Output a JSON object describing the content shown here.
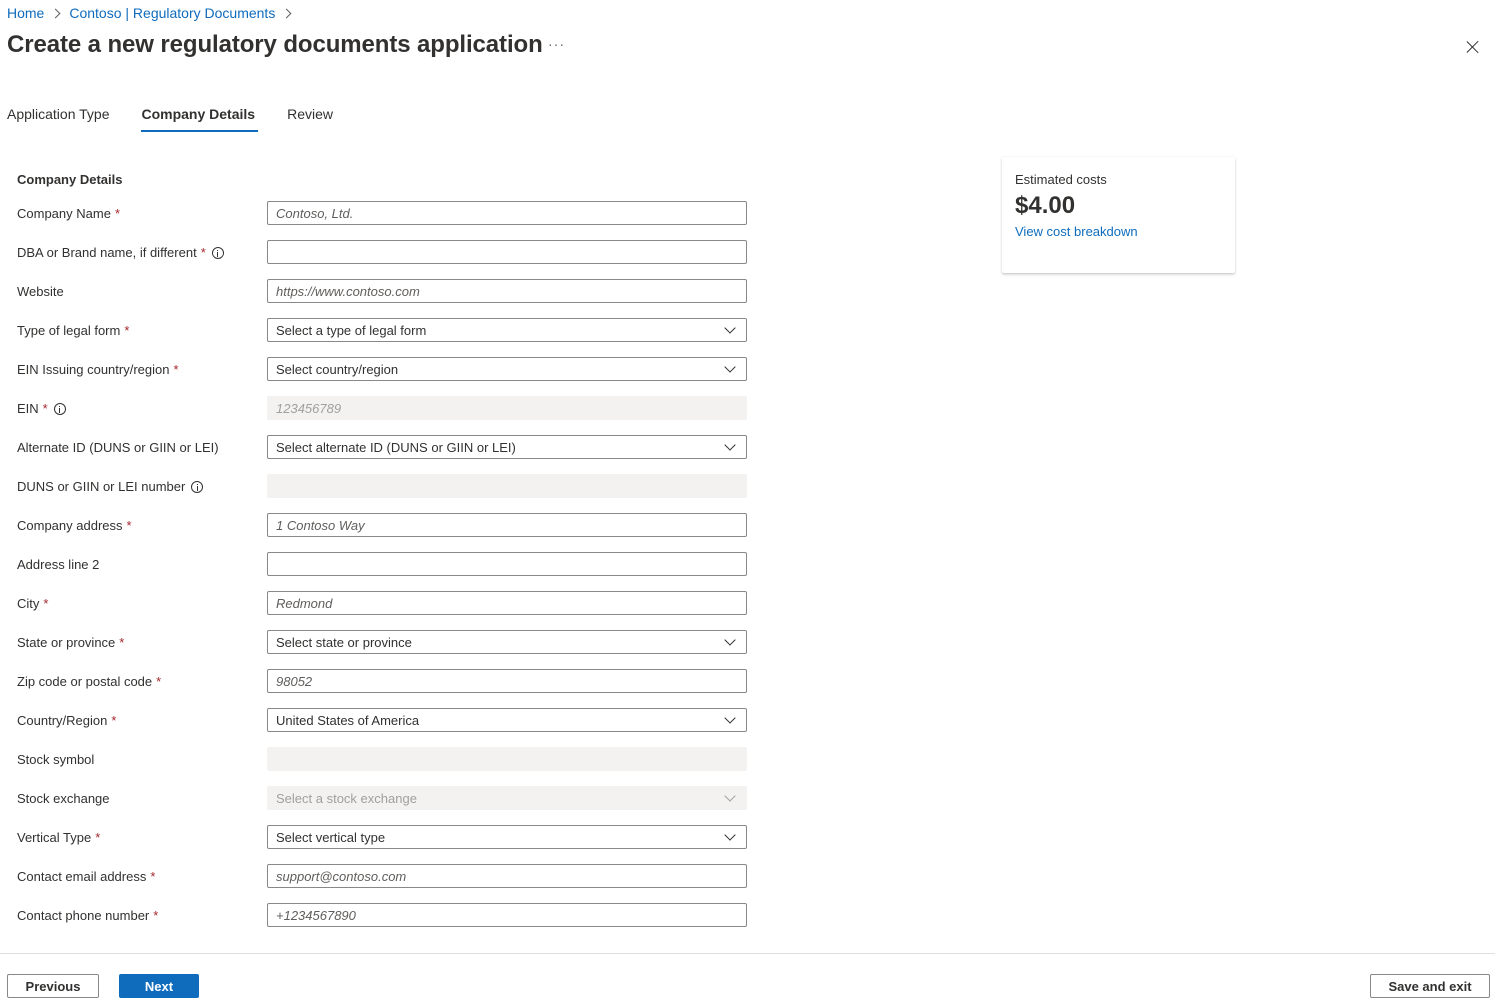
{
  "breadcrumb": {
    "items": [
      "Home",
      "Contoso | Regulatory Documents"
    ]
  },
  "header": {
    "title": "Create a new regulatory documents application",
    "more": "···"
  },
  "tabs": [
    {
      "label": "Application Type",
      "active": false
    },
    {
      "label": "Company Details",
      "active": true
    },
    {
      "label": "Review",
      "active": false
    }
  ],
  "form": {
    "section_title": "Company Details",
    "fields": {
      "company_name": {
        "label": "Company Name",
        "required": "*",
        "placeholder": "Contoso, Ltd."
      },
      "dba": {
        "label": "DBA or Brand name, if different",
        "required": "*",
        "placeholder": ""
      },
      "website": {
        "label": "Website",
        "placeholder": "https://www.contoso.com"
      },
      "legal_form": {
        "label": "Type of legal form",
        "required": "*",
        "value": "Select a type of legal form"
      },
      "ein_country": {
        "label": "EIN Issuing country/region",
        "required": "*",
        "value": "Select country/region"
      },
      "ein": {
        "label": "EIN",
        "required": "*",
        "placeholder": "123456789"
      },
      "alternate_id": {
        "label": "Alternate ID (DUNS or GIIN or LEI)",
        "value": "Select alternate ID (DUNS or GIIN or LEI)"
      },
      "duns_number": {
        "label": "DUNS or GIIN or LEI number",
        "placeholder": ""
      },
      "company_address": {
        "label": "Company address",
        "required": "*",
        "placeholder": "1 Contoso Way"
      },
      "address_line2": {
        "label": "Address line 2",
        "placeholder": ""
      },
      "city": {
        "label": "City",
        "required": "*",
        "placeholder": "Redmond"
      },
      "state": {
        "label": "State or province",
        "required": "*",
        "value": "Select state or province"
      },
      "zip": {
        "label": "Zip code or postal code",
        "required": "*",
        "placeholder": "98052"
      },
      "country": {
        "label": "Country/Region",
        "required": "*",
        "value": "United States of America"
      },
      "stock_symbol": {
        "label": "Stock symbol",
        "placeholder": ""
      },
      "stock_exchange": {
        "label": "Stock exchange",
        "value": "Select a stock exchange"
      },
      "vertical_type": {
        "label": "Vertical Type",
        "required": "*",
        "value": "Select vertical type"
      },
      "contact_email": {
        "label": "Contact email address",
        "required": "*",
        "placeholder": "support@contoso.com"
      },
      "contact_phone": {
        "label": "Contact phone number",
        "required": "*",
        "placeholder": "+1234567890"
      }
    }
  },
  "cost_card": {
    "label": "Estimated costs",
    "value": "$4.00",
    "link": "View cost breakdown"
  },
  "footer": {
    "previous": "Previous",
    "next": "Next",
    "save_exit": "Save and exit"
  },
  "colors": {
    "accent": "#0f6cbd",
    "required": "#a4262c",
    "disabled_bg": "#f3f2f1"
  }
}
